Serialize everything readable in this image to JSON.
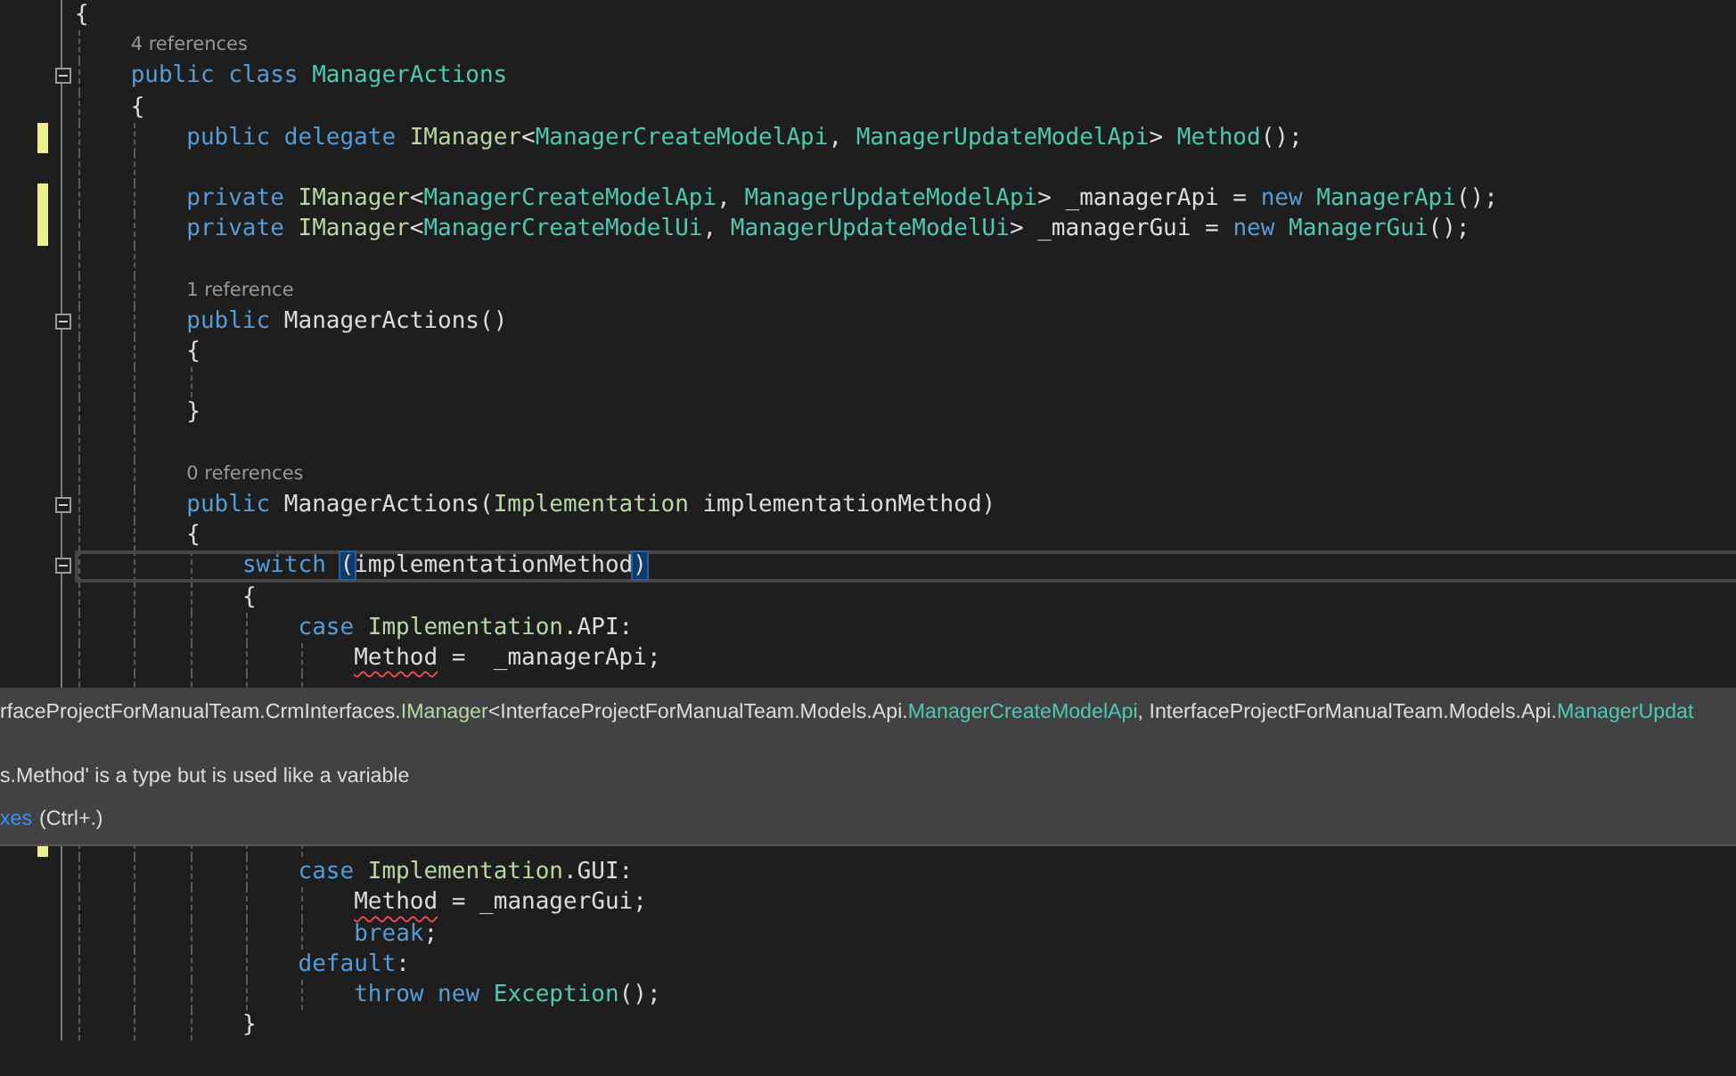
{
  "editor": {
    "lines": [
      {
        "kind": "code",
        "tokens": [
          {
            "kind": "text",
            "text": "{"
          }
        ],
        "children": [
          {
            "kind": "lens",
            "text": "4 references"
          },
          {
            "kind": "code",
            "fold": {
              "expanded": true
            },
            "tokens": [
              {
                "kind": "keyword",
                "text": "public class "
              },
              {
                "kind": "type",
                "text": "ManagerActions"
              }
            ]
          },
          {
            "kind": "code",
            "tokens": [
              {
                "kind": "text",
                "text": "{"
              }
            ],
            "children": [
              {
                "kind": "code",
                "changed": true,
                "tokens": [
                  {
                    "kind": "keyword",
                    "text": "public delegate "
                  },
                  {
                    "kind": "interface",
                    "text": "IManager"
                  },
                  {
                    "kind": "text",
                    "text": "<"
                  },
                  {
                    "kind": "type",
                    "text": "ManagerCreateModelApi"
                  },
                  {
                    "kind": "text",
                    "text": ", "
                  },
                  {
                    "kind": "type",
                    "text": "ManagerUpdateModelApi"
                  },
                  {
                    "kind": "text",
                    "text": "> "
                  },
                  {
                    "kind": "type",
                    "text": "Method"
                  },
                  {
                    "kind": "text",
                    "text": "();"
                  }
                ]
              },
              {
                "kind": "blank"
              },
              {
                "kind": "code",
                "changed": true,
                "tokens": [
                  {
                    "kind": "keyword",
                    "text": "private "
                  },
                  {
                    "kind": "interface",
                    "text": "IManager"
                  },
                  {
                    "kind": "text",
                    "text": "<"
                  },
                  {
                    "kind": "type",
                    "text": "ManagerCreateModelApi"
                  },
                  {
                    "kind": "text",
                    "text": ", "
                  },
                  {
                    "kind": "type",
                    "text": "ManagerUpdateModelApi"
                  },
                  {
                    "kind": "text",
                    "text": "> _managerApi = "
                  },
                  {
                    "kind": "keyword",
                    "text": "new "
                  },
                  {
                    "kind": "type",
                    "text": "ManagerApi"
                  },
                  {
                    "kind": "text",
                    "text": "();"
                  }
                ]
              },
              {
                "kind": "code",
                "changed": true,
                "tokens": [
                  {
                    "kind": "keyword",
                    "text": "private "
                  },
                  {
                    "kind": "interface",
                    "text": "IManager"
                  },
                  {
                    "kind": "text",
                    "text": "<"
                  },
                  {
                    "kind": "type",
                    "text": "ManagerCreateModelUi"
                  },
                  {
                    "kind": "text",
                    "text": ", "
                  },
                  {
                    "kind": "type",
                    "text": "ManagerUpdateModelUi"
                  },
                  {
                    "kind": "text",
                    "text": "> _managerGui = "
                  },
                  {
                    "kind": "keyword",
                    "text": "new "
                  },
                  {
                    "kind": "type",
                    "text": "ManagerGui"
                  },
                  {
                    "kind": "text",
                    "text": "();"
                  }
                ]
              },
              {
                "kind": "blank"
              },
              {
                "kind": "lens",
                "text": "1 reference"
              },
              {
                "kind": "code",
                "fold": {
                  "expanded": true
                },
                "tokens": [
                  {
                    "kind": "keyword",
                    "text": "public "
                  },
                  {
                    "kind": "text",
                    "text": "ManagerActions()"
                  }
                ]
              },
              {
                "kind": "code",
                "tokens": [
                  {
                    "kind": "text",
                    "text": "{"
                  }
                ],
                "children": [
                  {
                    "kind": "blank"
                  }
                ]
              },
              {
                "kind": "code",
                "tokens": [
                  {
                    "kind": "text",
                    "text": "}"
                  }
                ]
              },
              {
                "kind": "blank"
              },
              {
                "kind": "lens",
                "text": "0 references"
              },
              {
                "kind": "code",
                "fold": {
                  "expanded": true
                },
                "tokens": [
                  {
                    "kind": "keyword",
                    "text": "public "
                  },
                  {
                    "kind": "text",
                    "text": "ManagerActions("
                  },
                  {
                    "kind": "interface",
                    "text": "Implementation"
                  },
                  {
                    "kind": "text",
                    "text": " implementationMethod)"
                  }
                ]
              },
              {
                "kind": "code",
                "tokens": [
                  {
                    "kind": "text",
                    "text": "{"
                  }
                ],
                "children": [
                  {
                    "kind": "code",
                    "current": true,
                    "fold": {
                      "expanded": true
                    },
                    "tokens": [
                      {
                        "kind": "keyword",
                        "text": "switch "
                      },
                      {
                        "kind": "text",
                        "text": "(",
                        "matched": true
                      },
                      {
                        "kind": "text",
                        "text": "implementationMethod"
                      },
                      {
                        "kind": "text",
                        "text": ")",
                        "matched": true
                      }
                    ]
                  },
                  {
                    "kind": "code",
                    "tokens": [
                      {
                        "kind": "text",
                        "text": "{"
                      }
                    ],
                    "children": [
                      {
                        "kind": "code",
                        "tokens": [
                          {
                            "kind": "keyword",
                            "text": "case "
                          },
                          {
                            "kind": "interface",
                            "text": "Implementation"
                          },
                          {
                            "kind": "text",
                            "text": ".API:"
                          }
                        ],
                        "children": [
                          {
                            "kind": "code",
                            "tokens": [
                              {
                                "kind": "text",
                                "text": "Method",
                                "error": true
                              },
                              {
                                "kind": "text",
                                "text": " =  _managerApi;"
                              }
                            ]
                          },
                          {
                            "kind": "blank"
                          },
                          {
                            "kind": "blank"
                          },
                          {
                            "kind": "blank"
                          },
                          {
                            "kind": "blank"
                          },
                          {
                            "kind": "blank"
                          },
                          {
                            "kind": "blank",
                            "changed": true
                          }
                        ]
                      },
                      {
                        "kind": "code",
                        "tokens": [
                          {
                            "kind": "keyword",
                            "text": "case "
                          },
                          {
                            "kind": "interface",
                            "text": "Implementation"
                          },
                          {
                            "kind": "text",
                            "text": ".GUI:"
                          }
                        ],
                        "children": [
                          {
                            "kind": "code",
                            "tokens": [
                              {
                                "kind": "text",
                                "text": "Method",
                                "error": true
                              },
                              {
                                "kind": "text",
                                "text": " = _managerGui;"
                              }
                            ]
                          },
                          {
                            "kind": "code",
                            "tokens": [
                              {
                                "kind": "keyword",
                                "text": "break"
                              },
                              {
                                "kind": "text",
                                "text": ";"
                              }
                            ]
                          }
                        ]
                      },
                      {
                        "kind": "code",
                        "tokens": [
                          {
                            "kind": "keyword",
                            "text": "default"
                          },
                          {
                            "kind": "text",
                            "text": ":"
                          }
                        ],
                        "children": [
                          {
                            "kind": "code",
                            "tokens": [
                              {
                                "kind": "keyword",
                                "text": "throw new "
                              },
                              {
                                "kind": "type",
                                "text": "Exception"
                              },
                              {
                                "kind": "text",
                                "text": "();"
                              }
                            ]
                          }
                        ]
                      }
                    ]
                  },
                  {
                    "kind": "code",
                    "tokens": [
                      {
                        "kind": "text",
                        "text": "}"
                      }
                    ]
                  }
                ]
              }
            ]
          }
        ]
      }
    ]
  },
  "tooltip": {
    "signature": [
      {
        "kind": "text",
        "text": "rfaceProjectForManualTeam.CrmInterfaces."
      },
      {
        "kind": "interface",
        "text": "IManager"
      },
      {
        "kind": "text",
        "text": "<InterfaceProjectForManualTeam.Models.Api."
      },
      {
        "kind": "type",
        "text": "ManagerCreateModelApi"
      },
      {
        "kind": "text",
        "text": ", InterfaceProjectForManualTeam.Models.Api."
      },
      {
        "kind": "type",
        "text": "ManagerUpdat"
      }
    ],
    "message": "s.Method' is a type but is used like a variable",
    "fix_link": "xes",
    "fix_shortcut": "(Ctrl+.)"
  }
}
